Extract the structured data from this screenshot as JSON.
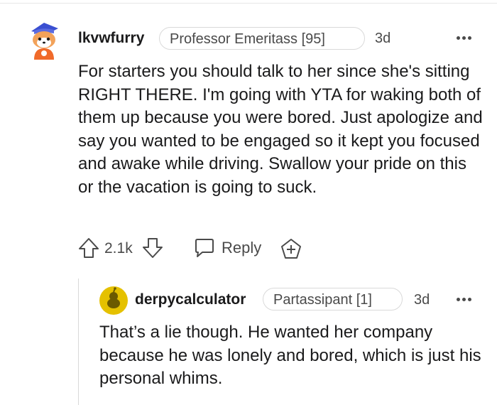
{
  "comment": {
    "username": "lkvwfurry",
    "flair": "Professor Emeritass [95]",
    "time": "3d",
    "body": "For starters you should talk to her since she's sitting RIGHT THERE. I'm going with YTA for waking both of them up because you were bored. Just apologize and say you wanted to be engaged so it kept you focused and awake while driving. Swallow your pride on this or the vacation is going to suck.",
    "votes": "2.1k",
    "reply_label": "Reply",
    "icons": [
      "upvote-icon",
      "downvote-icon",
      "reply-icon",
      "award-icon",
      "more-icon"
    ]
  },
  "reply": {
    "username": "derpycalculator",
    "flair": "Partassipant [1]",
    "time": "3d",
    "body": "That’s a lie though. He wanted her company because he was lonely and bored, which is just his personal whims."
  },
  "colors": {
    "text": "#1a1a1b",
    "meta": "#4a4a4a",
    "border": "#d9d9d9",
    "avatar_yellow": "#e5c100"
  }
}
